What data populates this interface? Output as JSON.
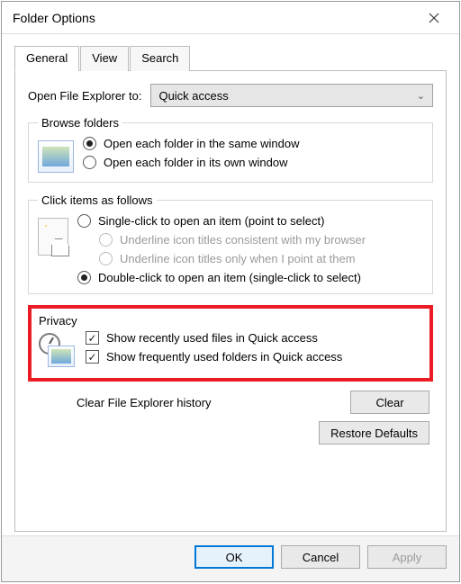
{
  "window": {
    "title": "Folder Options"
  },
  "tabs": {
    "general": "General",
    "view": "View",
    "search": "Search"
  },
  "open_to": {
    "label": "Open File Explorer to:",
    "value": "Quick access"
  },
  "browse": {
    "legend": "Browse folders",
    "same": "Open each folder in the same window",
    "own": "Open each folder in its own window"
  },
  "click": {
    "legend": "Click items as follows",
    "single": "Single-click to open an item (point to select)",
    "underline_browser": "Underline icon titles consistent with my browser",
    "underline_point": "Underline icon titles only when I point at them",
    "double": "Double-click to open an item (single-click to select)"
  },
  "privacy": {
    "legend": "Privacy",
    "recent": "Show recently used files in Quick access",
    "frequent": "Show frequently used folders in Quick access",
    "clear_label": "Clear File Explorer history",
    "clear_btn": "Clear"
  },
  "buttons": {
    "restore": "Restore Defaults",
    "ok": "OK",
    "cancel": "Cancel",
    "apply": "Apply"
  }
}
